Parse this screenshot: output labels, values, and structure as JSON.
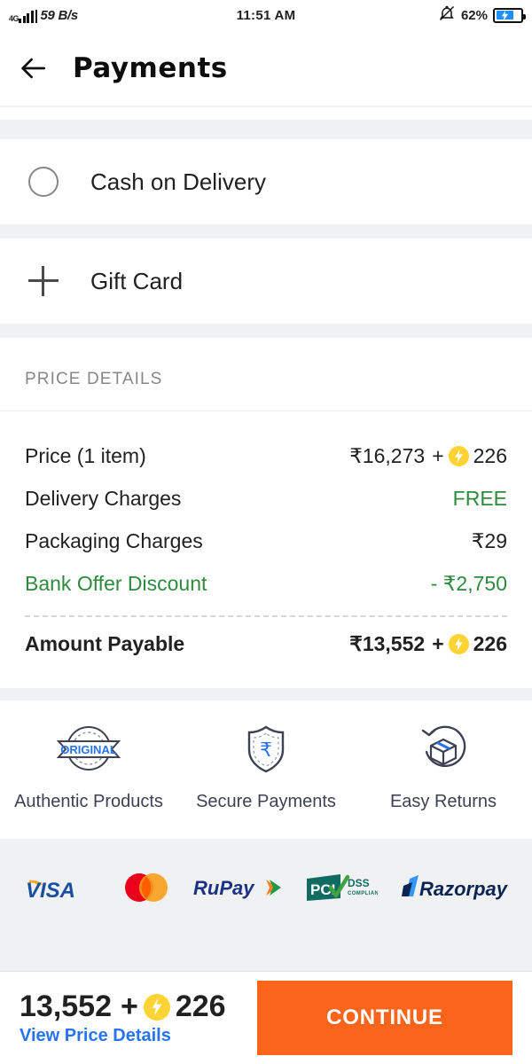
{
  "statusbar": {
    "network": "4G",
    "speed": "59 B/s",
    "time": "11:51 AM",
    "battery_pct": "62%",
    "bell_icon": "bell-muted-icon",
    "battery_icon": "battery-charging-icon"
  },
  "appbar": {
    "back_icon": "back-arrow-icon",
    "title": "Payments"
  },
  "payment_options": [
    {
      "label": "Cash on Delivery",
      "icon": "radio-unselected-icon",
      "selected": false
    },
    {
      "label": "Gift Card",
      "icon": "plus-icon"
    }
  ],
  "price_details": {
    "heading": "PRICE DETAILS",
    "rows": [
      {
        "label": "Price (1 item)",
        "value": "₹16,273",
        "plus": "+",
        "coins": "226",
        "has_coin": true,
        "style": "normal"
      },
      {
        "label": "Delivery Charges",
        "value": "FREE",
        "has_coin": false,
        "style": "green"
      },
      {
        "label": "Packaging Charges",
        "value": "₹29",
        "has_coin": false,
        "style": "normal"
      },
      {
        "label": "Bank Offer Discount",
        "value": "- ₹2,750",
        "has_coin": false,
        "style": "green-label"
      }
    ],
    "total": {
      "label": "Amount Payable",
      "value": "₹13,552",
      "plus": "+",
      "coins": "226",
      "has_coin": true
    }
  },
  "trust_badges": [
    {
      "label": "Authentic Products",
      "icon": "original-seal-icon",
      "badge_text": "ORIGINAL"
    },
    {
      "label": "Secure Payments",
      "icon": "shield-rupee-icon"
    },
    {
      "label": "Easy Returns",
      "icon": "return-box-icon"
    }
  ],
  "payment_logos": [
    {
      "name": "visa-logo",
      "label": "VISA"
    },
    {
      "name": "mastercard-logo",
      "label": "Mastercard"
    },
    {
      "name": "rupay-logo",
      "label": "RuPay"
    },
    {
      "name": "pci-dss-logo",
      "label": "PCI DSS COMPLIANT"
    },
    {
      "name": "razorpay-logo",
      "label": "Razorpay"
    }
  ],
  "bottombar": {
    "amount": "13,552",
    "plus": "+",
    "coins": "226",
    "link": "View Price Details",
    "continue_label": "CONTINUE"
  },
  "colors": {
    "accent_orange": "#fb641b",
    "link_blue": "#2874f0",
    "green": "#2e8b3d",
    "coin_yellow": "#ffd333",
    "page_gray": "#f0f1f3"
  }
}
